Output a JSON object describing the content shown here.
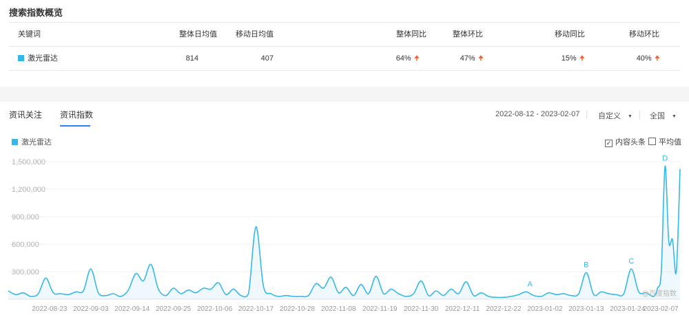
{
  "overview": {
    "title": "搜索指数概览",
    "headers": [
      "关键词",
      "整体日均值",
      "移动日均值",
      "整体同比",
      "整体环比",
      "移动同比",
      "移动环比"
    ],
    "row": {
      "keyword": "激光雷达",
      "overall_avg": "814",
      "mobile_avg": "407",
      "overall_yoy": "64%",
      "overall_mom": "47%",
      "mobile_yoy": "15%",
      "mobile_mom": "40%"
    },
    "trend_icon": "arrow-up-icon",
    "accent_color": "#35b8e8",
    "up_color": "#f0602c"
  },
  "panel": {
    "tabs": [
      {
        "label": "资讯关注"
      },
      {
        "label": "资讯指数"
      }
    ],
    "active_tab": 1,
    "date_range": "2022-08-12 - 2023-02-07",
    "period_select": "自定义",
    "region_select": "全国",
    "legend_label": "激光雷达",
    "checkboxes": [
      {
        "label": "内容头条",
        "checked": true
      },
      {
        "label": "平均值",
        "checked": false
      }
    ],
    "watermark": "@百度指数"
  },
  "chart_data": {
    "type": "area",
    "title": "",
    "xlabel": "",
    "ylabel": "",
    "ylim": [
      0,
      1500000
    ],
    "y_ticks": [
      300000,
      600000,
      900000,
      1200000,
      1500000
    ],
    "y_tick_labels": [
      "300,000",
      "600,000",
      "900,000",
      "1,200,000",
      "1,500,000"
    ],
    "x_tick_labels": [
      "2022-08-23",
      "2022-09-03",
      "2022-09-14",
      "2022-09-25",
      "2022-10-06",
      "2022-10-17",
      "2022-10-28",
      "2022-11-08",
      "2022-11-19",
      "2022-11-30",
      "2022-12-11",
      "2022-12-22",
      "2023-01-02",
      "2023-01-13",
      "2023-01-24",
      "2023-02-07"
    ],
    "grid": true,
    "series": [
      {
        "name": "激光雷达",
        "color": "#35b8e8",
        "x": [
          "2022-08-12",
          "2022-08-14",
          "2022-08-16",
          "2022-08-18",
          "2022-08-20",
          "2022-08-22",
          "2022-08-24",
          "2022-08-26",
          "2022-08-28",
          "2022-08-30",
          "2022-09-01",
          "2022-09-03",
          "2022-09-05",
          "2022-09-07",
          "2022-09-09",
          "2022-09-11",
          "2022-09-13",
          "2022-09-15",
          "2022-09-17",
          "2022-09-19",
          "2022-09-21",
          "2022-09-23",
          "2022-09-25",
          "2022-09-27",
          "2022-09-29",
          "2022-10-01",
          "2022-10-03",
          "2022-10-05",
          "2022-10-07",
          "2022-10-09",
          "2022-10-11",
          "2022-10-13",
          "2022-10-15",
          "2022-10-17",
          "2022-10-19",
          "2022-10-21",
          "2022-10-23",
          "2022-10-25",
          "2022-10-27",
          "2022-10-29",
          "2022-10-31",
          "2022-11-02",
          "2022-11-04",
          "2022-11-06",
          "2022-11-08",
          "2022-11-10",
          "2022-11-12",
          "2022-11-14",
          "2022-11-16",
          "2022-11-18",
          "2022-11-20",
          "2022-11-22",
          "2022-11-24",
          "2022-11-26",
          "2022-11-28",
          "2022-11-30",
          "2022-12-02",
          "2022-12-04",
          "2022-12-06",
          "2022-12-08",
          "2022-12-10",
          "2022-12-12",
          "2022-12-14",
          "2022-12-16",
          "2022-12-18",
          "2022-12-20",
          "2022-12-22",
          "2022-12-24",
          "2022-12-26",
          "2022-12-28",
          "2022-12-30",
          "2023-01-01",
          "2023-01-03",
          "2023-01-05",
          "2023-01-07",
          "2023-01-09",
          "2023-01-11",
          "2023-01-13",
          "2023-01-15",
          "2023-01-17",
          "2023-01-19",
          "2023-01-21",
          "2023-01-23",
          "2023-01-25",
          "2023-01-27",
          "2023-01-29",
          "2023-01-31",
          "2023-02-01",
          "2023-02-02",
          "2023-02-03",
          "2023-02-04",
          "2023-02-05",
          "2023-02-06",
          "2023-02-07"
        ],
        "values": [
          90000,
          50000,
          70000,
          30000,
          60000,
          230000,
          70000,
          60000,
          50000,
          80000,
          90000,
          330000,
          70000,
          40000,
          60000,
          30000,
          100000,
          280000,
          200000,
          380000,
          110000,
          40000,
          120000,
          60000,
          100000,
          70000,
          120000,
          110000,
          180000,
          50000,
          110000,
          40000,
          60000,
          790000,
          140000,
          60000,
          30000,
          40000,
          30000,
          30000,
          40000,
          170000,
          120000,
          240000,
          70000,
          130000,
          40000,
          160000,
          60000,
          250000,
          60000,
          110000,
          60000,
          30000,
          60000,
          200000,
          40000,
          90000,
          40000,
          110000,
          60000,
          190000,
          40000,
          70000,
          30000,
          20000,
          20000,
          30000,
          50000,
          80000,
          40000,
          30000,
          70000,
          50000,
          60000,
          40000,
          60000,
          290000,
          50000,
          80000,
          60000,
          50000,
          60000,
          330000,
          80000,
          70000,
          30000,
          120000,
          300000,
          1450000,
          630000,
          650000,
          300000,
          1420000
        ]
      }
    ],
    "annotations": [
      {
        "label": "A",
        "x": "2022-12-29"
      },
      {
        "label": "B",
        "x": "2023-01-13"
      },
      {
        "label": "C",
        "x": "2023-01-25"
      },
      {
        "label": "D",
        "x": "2023-02-03"
      }
    ]
  }
}
